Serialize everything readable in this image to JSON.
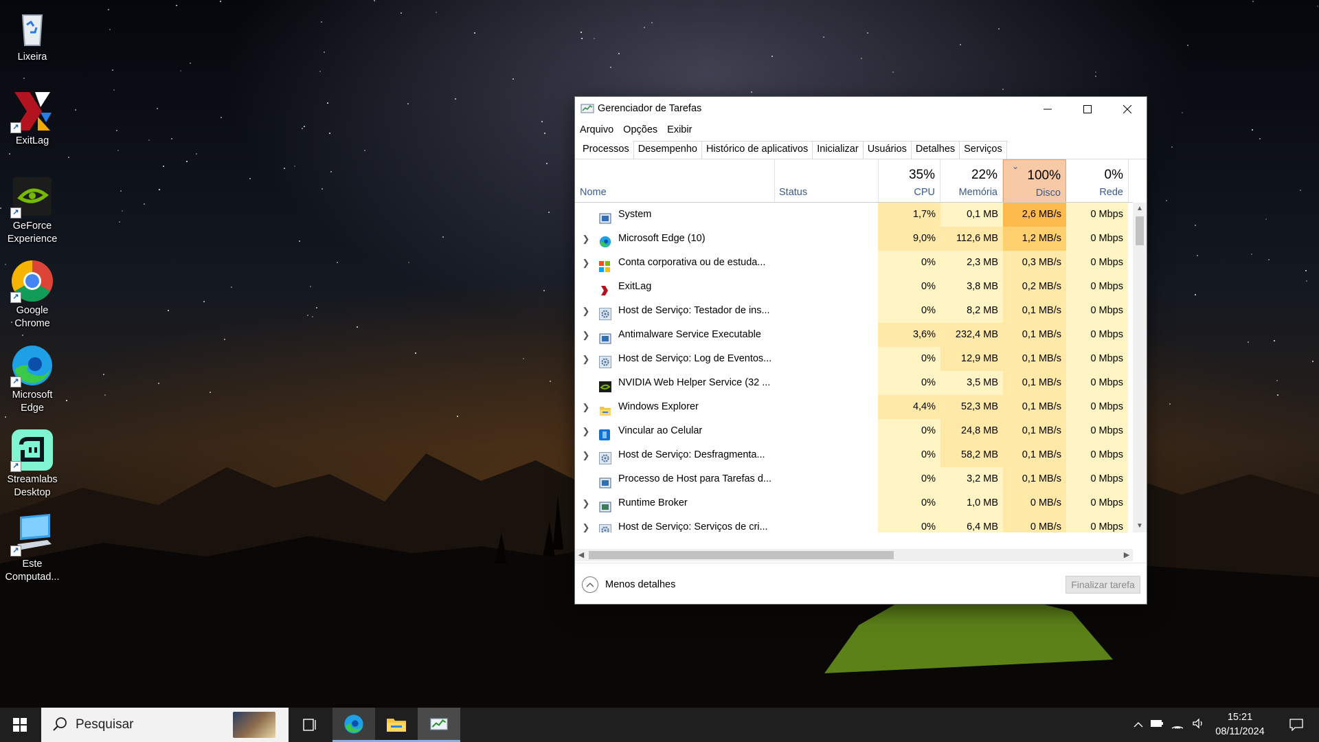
{
  "desktop": {
    "icons": [
      {
        "label": "Lixeira",
        "icon": "recycle-bin-icon"
      },
      {
        "label": "ExitLag",
        "icon": "exitlag-icon"
      },
      {
        "label": "GeForce Experience",
        "icon": "geforce-experience-icon"
      },
      {
        "label": "Google Chrome",
        "icon": "chrome-icon"
      },
      {
        "label": "Microsoft Edge",
        "icon": "edge-icon"
      },
      {
        "label": "Streamlabs Desktop",
        "icon": "streamlabs-icon"
      },
      {
        "label": "Este Computad...",
        "icon": "this-pc-icon"
      }
    ]
  },
  "window": {
    "title": "Gerenciador de Tarefas",
    "menu": [
      "Arquivo",
      "Opções",
      "Exibir"
    ],
    "tabs": [
      "Processos",
      "Desempenho",
      "Histórico de aplicativos",
      "Inicializar",
      "Usuários",
      "Detalhes",
      "Serviços"
    ],
    "active_tab": "Processos",
    "columns": {
      "name": "Nome",
      "status": "Status",
      "cpu": {
        "pct": "35%",
        "label": "CPU"
      },
      "memory": {
        "pct": "22%",
        "label": "Memória"
      },
      "disk": {
        "pct": "100%",
        "label": "Disco"
      },
      "network": {
        "pct": "0%",
        "label": "Rede"
      }
    },
    "sorted_column": "disk",
    "processes": [
      {
        "name": "System",
        "expandable": false,
        "icon": "system-icon",
        "cpu": "1,7%",
        "memory": "0,1 MB",
        "disk": "2,6 MB/s",
        "network": "0 Mbps"
      },
      {
        "name": "Microsoft Edge (10)",
        "expandable": true,
        "icon": "edge-icon",
        "cpu": "9,0%",
        "memory": "112,6 MB",
        "disk": "1,2 MB/s",
        "network": "0 Mbps"
      },
      {
        "name": "Conta corporativa ou de estuda...",
        "expandable": true,
        "icon": "windows-logo-icon",
        "cpu": "0%",
        "memory": "2,3 MB",
        "disk": "0,3 MB/s",
        "network": "0 Mbps"
      },
      {
        "name": "ExitLag",
        "expandable": false,
        "icon": "exitlag-icon",
        "cpu": "0%",
        "memory": "3,8 MB",
        "disk": "0,2 MB/s",
        "network": "0 Mbps"
      },
      {
        "name": "Host de Serviço: Testador de ins...",
        "expandable": true,
        "icon": "gear-icon",
        "cpu": "0%",
        "memory": "8,2 MB",
        "disk": "0,1 MB/s",
        "network": "0 Mbps"
      },
      {
        "name": "Antimalware Service Executable",
        "expandable": true,
        "icon": "system-icon",
        "cpu": "3,6%",
        "memory": "232,4 MB",
        "disk": "0,1 MB/s",
        "network": "0 Mbps"
      },
      {
        "name": "Host de Serviço: Log de Eventos...",
        "expandable": true,
        "icon": "gear-icon",
        "cpu": "0%",
        "memory": "12,9 MB",
        "disk": "0,1 MB/s",
        "network": "0 Mbps"
      },
      {
        "name": "NVIDIA Web Helper Service (32 ...",
        "expandable": false,
        "icon": "nvidia-icon",
        "cpu": "0%",
        "memory": "3,5 MB",
        "disk": "0,1 MB/s",
        "network": "0 Mbps"
      },
      {
        "name": "Windows Explorer",
        "expandable": true,
        "icon": "folder-icon",
        "cpu": "4,4%",
        "memory": "52,3 MB",
        "disk": "0,1 MB/s",
        "network": "0 Mbps"
      },
      {
        "name": "Vincular ao Celular",
        "expandable": true,
        "icon": "phone-link-icon",
        "cpu": "0%",
        "memory": "24,8 MB",
        "disk": "0,1 MB/s",
        "network": "0 Mbps"
      },
      {
        "name": "Host de Serviço: Desfragmenta...",
        "expandable": true,
        "icon": "gear-icon",
        "cpu": "0%",
        "memory": "58,2 MB",
        "disk": "0,1 MB/s",
        "network": "0 Mbps"
      },
      {
        "name": "Processo de Host para Tarefas d...",
        "expandable": false,
        "icon": "system-icon",
        "cpu": "0%",
        "memory": "3,2 MB",
        "disk": "0,1 MB/s",
        "network": "0 Mbps"
      },
      {
        "name": "Runtime Broker",
        "expandable": true,
        "icon": "runtime-broker-icon",
        "cpu": "0%",
        "memory": "1,0 MB",
        "disk": "0 MB/s",
        "network": "0 Mbps"
      },
      {
        "name": "Host de Serviço: Serviços de cri...",
        "expandable": true,
        "icon": "gear-icon",
        "cpu": "0%",
        "memory": "6,4 MB",
        "disk": "0 MB/s",
        "network": "0 Mbps"
      }
    ],
    "footer": {
      "less_details": "Menos detalhes",
      "end_task": "Finalizar tarefa"
    }
  },
  "taskbar": {
    "search_placeholder": "Pesquisar",
    "time": "15:21",
    "date": "08/11/2024"
  },
  "colors": {
    "heat_light": "#fff4c4",
    "heat_medium": "#ffe9a8",
    "heat_high": "#ffd06e",
    "heat_peak": "#fdbb4d",
    "sorted_header": "#f8c9a5"
  }
}
